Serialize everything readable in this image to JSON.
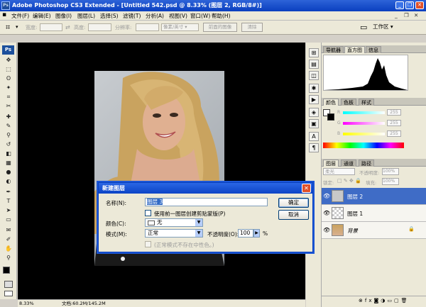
{
  "window": {
    "title": "Adobe Photoshop CS3 Extended - [Untitled 542.psd @ 8.33% (图层 2, RGB/8#)]",
    "app_icon": "Ps"
  },
  "menu": [
    "文件(F)",
    "编辑(E)",
    "图像(I)",
    "图层(L)",
    "选择(S)",
    "滤镜(T)",
    "分析(A)",
    "视图(V)",
    "窗口(W)",
    "帮助(H)"
  ],
  "options": {
    "width_label": "宽度:",
    "height_label": "高度:",
    "resolution_label": "分辨率:",
    "unit": "像素/英寸",
    "front_image_btn": "前面的图像",
    "clear_btn": "清除",
    "workspace": "工作区 ▾"
  },
  "toolbox": {
    "logo": "Ps"
  },
  "status": {
    "zoom": "8.33%",
    "doc": "文档:60.2M/145.2M"
  },
  "panels": {
    "nav_tabs": [
      "导航器",
      "直方图",
      "信息"
    ],
    "color_tabs": [
      "颜色",
      "色板",
      "样式"
    ],
    "color_values": [
      "255",
      "255",
      "255"
    ],
    "layers_tabs": [
      "图层",
      "通道",
      "路径"
    ],
    "blend": "柔光",
    "opacity_label": "不透明度:",
    "opacity": "100%",
    "lock_label": "锁定:",
    "fill_label": "填充:",
    "fill": "100%",
    "layers": [
      {
        "name": "图层 2",
        "selected": true
      },
      {
        "name": "图层 1",
        "selected": false
      },
      {
        "name": "背景",
        "selected": false
      }
    ]
  },
  "dialog": {
    "title": "新建图层",
    "name_label": "名称(N):",
    "name_value": "图层 3",
    "clip_checkbox": "使用前一图层创建剪贴蒙版(P)",
    "color_label": "颜色(C):",
    "color_value": "无",
    "mode_label": "模式(M):",
    "mode_value": "正常",
    "opacity_label": "不透明度(O):",
    "opacity_value": "100",
    "percent": "%",
    "neutral_checkbox": "(正常模式不存在中性色。)",
    "ok": "确定",
    "cancel": "取消"
  },
  "colors": {
    "titlebar": "#0a3fbf",
    "selection": "#3f6cc6",
    "canvas": "#000000"
  }
}
